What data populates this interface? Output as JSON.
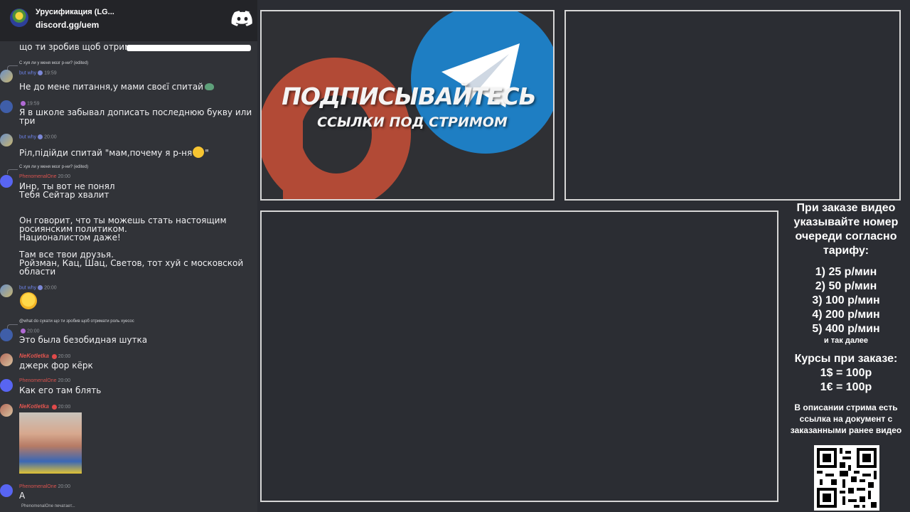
{
  "server": {
    "name": "Урусификация (LG...",
    "invite": "discord.gg/uem"
  },
  "chat": {
    "top_fragment": "що ти зробив щоб отрим",
    "messages": [
      {
        "reply": "С хуя ли у меня мозг р-ни? (edited)",
        "author": "but why",
        "time": "19:59",
        "text": "Не до мене питання,у мами своєї спитай"
      },
      {
        "author": "",
        "time": "19:59",
        "text": "Я в школе забывал дописать последнюю букву или три"
      },
      {
        "author": "but why",
        "time": "20:00",
        "text": "Ріл,підійди спитай \"мам,почему я р-ня",
        "text_end": "\""
      },
      {
        "reply": "С хуя ли у меня мозг р-ни? (edited)",
        "author": "PhenomenalOne",
        "time": "20:00",
        "text": "Инр, ты вот не понял\nТебя Сейтар хвалит\n\n\nОн говорит, что ты можешь стать настоящим\nросиянским политиком.\nНационалистом даже!\n\nТам все твои друзья.\nРойзман, Кац, Шац, Светов, тот хуй с московской\nобласти"
      },
      {
        "author": "but why",
        "time": "20:00",
        "text": ""
      },
      {
        "reply": "@what do сукати що ти зробив щоб отримати роль хуесос",
        "author": "",
        "time": "20:00",
        "text": "Это была безобидная шутка"
      },
      {
        "author": "NeKotletka",
        "time": "20:00",
        "text": "джерк фор кёрк"
      },
      {
        "author": "PhenomenalOne",
        "time": "20:00",
        "text": "Как его там блять"
      },
      {
        "author": "NeKotletka",
        "time": "20:00",
        "text": ""
      },
      {
        "author": "PhenomenalOne",
        "time": "20:00",
        "text": "А"
      }
    ],
    "typing": "PhenomenalOne печатает..."
  },
  "promo": {
    "title": "ПОДПИСЫВАЙТЕСЬ",
    "subtitle": "ССЫЛКИ ПОД СТРИМОМ"
  },
  "info": {
    "intro": "При заказе видео указывайте номер очереди согласно тарифу:",
    "tariffs": [
      "1) 25 р/мин",
      "2) 50 р/мин",
      "3) 100 р/мин",
      "4) 200 р/мин",
      "5) 400 р/мин"
    ],
    "etc": "и так далее",
    "rates_title": "Курсы при заказе:",
    "rates": [
      "1$ = 100р",
      "1€ = 100р"
    ],
    "description": "В описании стрима есть ссылка на документ с заказанными ранее видео"
  },
  "colors": {
    "telegram": "#1e7ec3",
    "patreon": "#b24a36",
    "discord": "#5865f2"
  }
}
